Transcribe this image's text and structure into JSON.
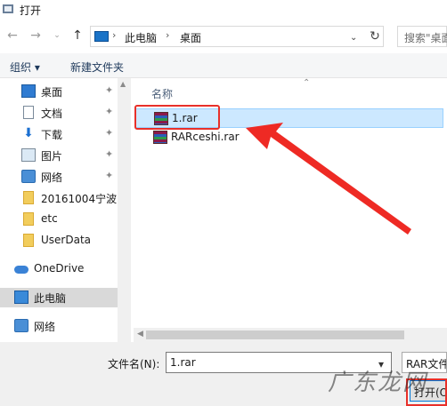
{
  "window": {
    "title": "打开"
  },
  "address": {
    "segments": [
      "此电脑",
      "桌面"
    ],
    "search_placeholder": "搜索\"桌面\""
  },
  "toolbar": {
    "organize": "组织 ▾",
    "new_folder": "新建文件夹"
  },
  "sidebar": {
    "items": [
      {
        "label": "桌面",
        "icon": "desktop-icon",
        "pinned": true
      },
      {
        "label": "文档",
        "icon": "document-icon",
        "pinned": true
      },
      {
        "label": "下载",
        "icon": "download-icon",
        "pinned": true
      },
      {
        "label": "图片",
        "icon": "picture-icon",
        "pinned": true
      },
      {
        "label": "网络",
        "icon": "network-icon",
        "pinned": true
      },
      {
        "label": "20161004宁波",
        "icon": "folder-icon",
        "pinned": false
      },
      {
        "label": "etc",
        "icon": "folder-icon",
        "pinned": false
      },
      {
        "label": "UserData",
        "icon": "folder-icon",
        "pinned": false
      },
      {
        "label": "OneDrive",
        "icon": "cloud-icon",
        "pinned": false
      },
      {
        "label": "此电脑",
        "icon": "computer-icon",
        "pinned": false,
        "selected": true
      },
      {
        "label": "网络",
        "icon": "network-icon",
        "pinned": false
      }
    ]
  },
  "main": {
    "column_name": "名称",
    "files": [
      {
        "name": "1.rar",
        "selected": true
      },
      {
        "name": "RARceshi.rar",
        "selected": false
      }
    ]
  },
  "bottom": {
    "filename_label": "文件名(N):",
    "filename_value": "1.rar",
    "filetype_value": "RAR文件",
    "open_label": "打开(O)"
  },
  "watermark": "广东龙网",
  "colors": {
    "highlight": "#e8302a",
    "selection": "#cce8ff",
    "accent": "#0078d7"
  }
}
